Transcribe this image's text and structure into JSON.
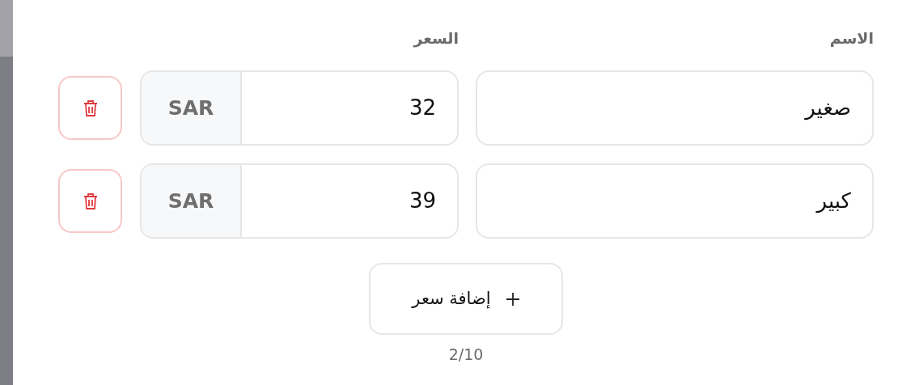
{
  "headers": {
    "name": "الاسم",
    "price": "السعر"
  },
  "rows": [
    {
      "name": "صغير",
      "price": "32",
      "currency": "SAR"
    },
    {
      "name": "كبير",
      "price": "39",
      "currency": "SAR"
    }
  ],
  "add_button": {
    "label": "إضافة سعر"
  },
  "counter": "2/10"
}
